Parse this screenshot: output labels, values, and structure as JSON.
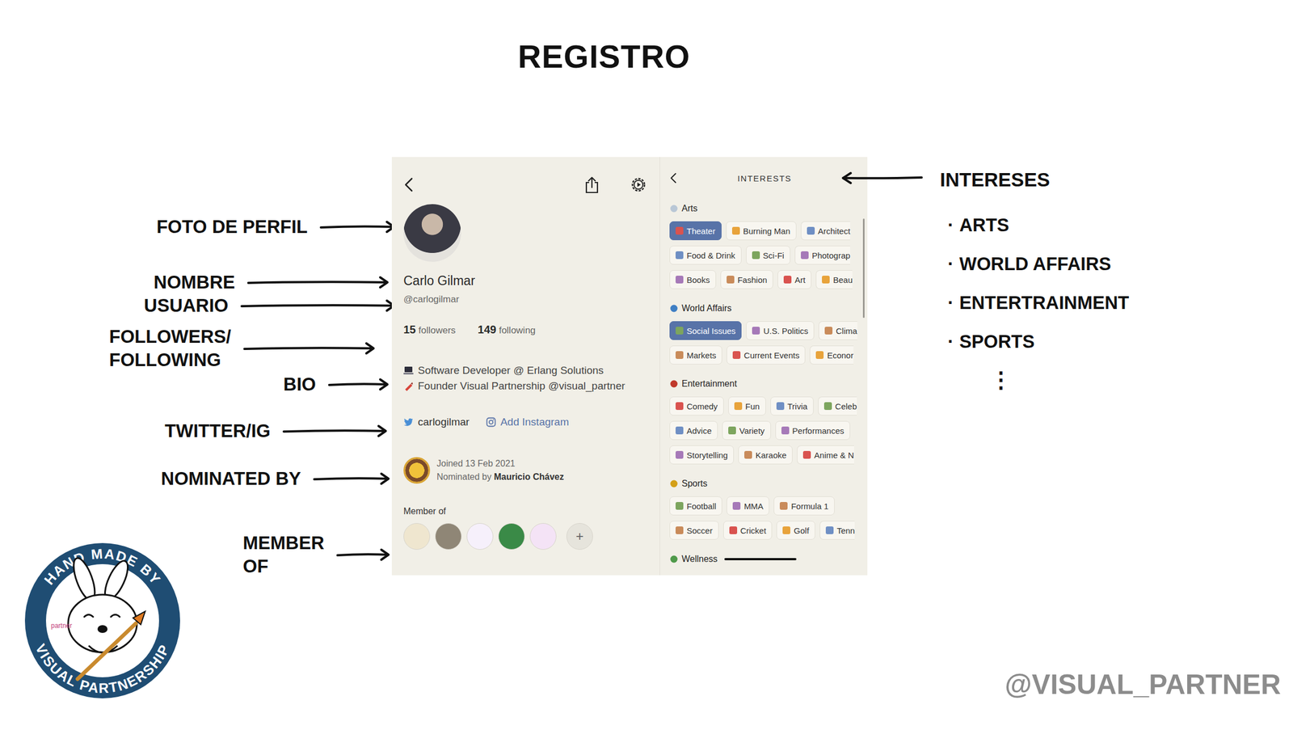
{
  "slide": {
    "title": "REGISTRO",
    "handle": "@VISUAL_PARTNER"
  },
  "annotations": [
    {
      "lines": [
        "FOTO DE PERFIL"
      ]
    },
    {
      "lines": [
        "NOMBRE"
      ]
    },
    {
      "lines": [
        "USUARIO"
      ]
    },
    {
      "lines": [
        "FOLLOWERS/",
        "FOLLOWING"
      ]
    },
    {
      "lines": [
        "BIO"
      ]
    },
    {
      "lines": [
        "TWITTER/IG"
      ]
    },
    {
      "lines": [
        "NOMINATED BY"
      ]
    },
    {
      "lines": [
        "MEMBER",
        "OF"
      ]
    }
  ],
  "interests_note": {
    "label": "INTERESES",
    "bullet": "·",
    "items": [
      "ARTS",
      "WORLD AFFAIRS",
      "ENTERTRAINMENT",
      "SPORTS"
    ],
    "more": "⋮"
  },
  "logo": {
    "top": "HAND MADE BY",
    "bottom": "VISUAL PARTNERSHIP",
    "badge": "partner"
  },
  "profile": {
    "name": "Carlo Gilmar",
    "username": "@carlogilmar",
    "followers": {
      "count": "15",
      "label": "followers"
    },
    "following": {
      "count": "149",
      "label": "following"
    },
    "bio": [
      "Software Developer @ Erlang Solutions",
      "Founder Visual Partnership @visual_partner"
    ],
    "twitter": "carlogilmar",
    "instagram": "Add Instagram",
    "joined": "Joined 13 Feb 2021",
    "nominated_by": {
      "prefix": "Nominated by",
      "name": "Mauricio Chávez"
    },
    "member_of": {
      "label": "Member of",
      "clubs": [
        {
          "color": "#efe6cf"
        },
        {
          "color": "#8f8676"
        },
        {
          "color": "#f6f0fb"
        },
        {
          "color": "#3a8a47"
        },
        {
          "color": "#f4e3f6"
        }
      ],
      "add": "+"
    }
  },
  "interests": {
    "title": "INTERESTS",
    "categories": [
      {
        "name": "Arts",
        "rows": [
          [
            {
              "label": "Theater",
              "selected": true,
              "cut": false
            },
            {
              "label": "Burning Man",
              "selected": false,
              "cut": false
            },
            {
              "label": "Architect",
              "selected": false,
              "cut": true
            }
          ],
          [
            {
              "label": "Food & Drink",
              "selected": false,
              "cut": false
            },
            {
              "label": "Sci-Fi",
              "selected": false,
              "cut": false
            },
            {
              "label": "Photograp",
              "selected": false,
              "cut": true
            }
          ],
          [
            {
              "label": "Books",
              "selected": false,
              "cut": false
            },
            {
              "label": "Fashion",
              "selected": false,
              "cut": false
            },
            {
              "label": "Art",
              "selected": false,
              "cut": false
            },
            {
              "label": "Beau",
              "selected": false,
              "cut": true
            }
          ]
        ]
      },
      {
        "name": "World Affairs",
        "rows": [
          [
            {
              "label": "Social Issues",
              "selected": true,
              "cut": false
            },
            {
              "label": "U.S. Politics",
              "selected": false,
              "cut": false
            },
            {
              "label": "Clima",
              "selected": false,
              "cut": true
            }
          ],
          [
            {
              "label": "Markets",
              "selected": false,
              "cut": false
            },
            {
              "label": "Current Events",
              "selected": false,
              "cut": false
            },
            {
              "label": "Econor",
              "selected": false,
              "cut": true
            }
          ]
        ]
      },
      {
        "name": "Entertainment",
        "rows": [
          [
            {
              "label": "Comedy",
              "selected": false,
              "cut": false
            },
            {
              "label": "Fun",
              "selected": false,
              "cut": false
            },
            {
              "label": "Trivia",
              "selected": false,
              "cut": false
            },
            {
              "label": "Celeb",
              "selected": false,
              "cut": true
            }
          ],
          [
            {
              "label": "Advice",
              "selected": false,
              "cut": false
            },
            {
              "label": "Variety",
              "selected": false,
              "cut": false
            },
            {
              "label": "Performances",
              "selected": false,
              "cut": false
            }
          ],
          [
            {
              "label": "Storytelling",
              "selected": false,
              "cut": false
            },
            {
              "label": "Karaoke",
              "selected": false,
              "cut": false
            },
            {
              "label": "Anime & N",
              "selected": false,
              "cut": true
            }
          ]
        ]
      },
      {
        "name": "Sports",
        "rows": [
          [
            {
              "label": "Football",
              "selected": false,
              "cut": false
            },
            {
              "label": "MMA",
              "selected": false,
              "cut": false
            },
            {
              "label": "Formula 1",
              "selected": false,
              "cut": false
            }
          ],
          [
            {
              "label": "Soccer",
              "selected": false,
              "cut": false
            },
            {
              "label": "Cricket",
              "selected": false,
              "cut": false
            },
            {
              "label": "Golf",
              "selected": false,
              "cut": false
            },
            {
              "label": "Tenn",
              "selected": false,
              "cut": true
            }
          ]
        ]
      },
      {
        "name": "Wellness",
        "rows": []
      }
    ]
  }
}
